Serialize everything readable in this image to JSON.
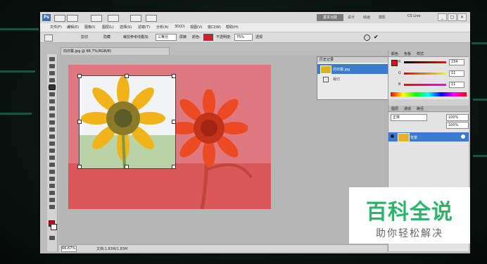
{
  "title_bar": {
    "app_logo": "Ps",
    "workspace_active": "基本功能",
    "workspace_tabs": [
      "设计",
      "绘画",
      "摄影"
    ],
    "cs_live": "CS Live",
    "window_buttons": [
      "_",
      "□",
      "×"
    ]
  },
  "menu": {
    "items": [
      "文件(F)",
      "编辑(E)",
      "图像(I)",
      "图层(L)",
      "选择(S)",
      "滤镜(T)",
      "分析(A)",
      "3D(D)",
      "视图(V)",
      "窗口(W)",
      "帮助(H)"
    ]
  },
  "options_bar": {
    "cut": "剪切",
    "hide": "隐藏",
    "reference_label": "裁剪参考线叠加:",
    "reference_value": "三等分",
    "shield_label": "屏蔽",
    "color_label": "颜色:",
    "opacity_label": "不透明度:",
    "opacity_value": "75%",
    "perspective": "透视"
  },
  "document": {
    "tab": "向日葵.jpg @ 66.7%(RGB/8)",
    "zoom": "66.67%",
    "doc_size": "文档:1.83M/1.83M"
  },
  "history_panel": {
    "title": "历史记录",
    "item_name": "向日葵.jpg",
    "step": "裁切"
  },
  "color_panel": {
    "tabs": [
      "颜色",
      "色板",
      "样式"
    ],
    "r_label": "R",
    "r_value": "234",
    "g_label": "G",
    "g_value": "11",
    "b_label": "B",
    "b_value": "11"
  },
  "layers_panel": {
    "tabs": [
      "图层",
      "通道",
      "路径"
    ],
    "blend_mode": "正常",
    "opacity": "100%",
    "fill": "100%",
    "layer_name": "背景"
  },
  "watermark": {
    "main": "百科全说",
    "sub": "助你轻松解决"
  },
  "colors": {
    "fg": "#cc0000",
    "selection_blue": "#3a7ad0",
    "crop_overlay": "#e0787f",
    "brand_green": "#2bb56b"
  }
}
